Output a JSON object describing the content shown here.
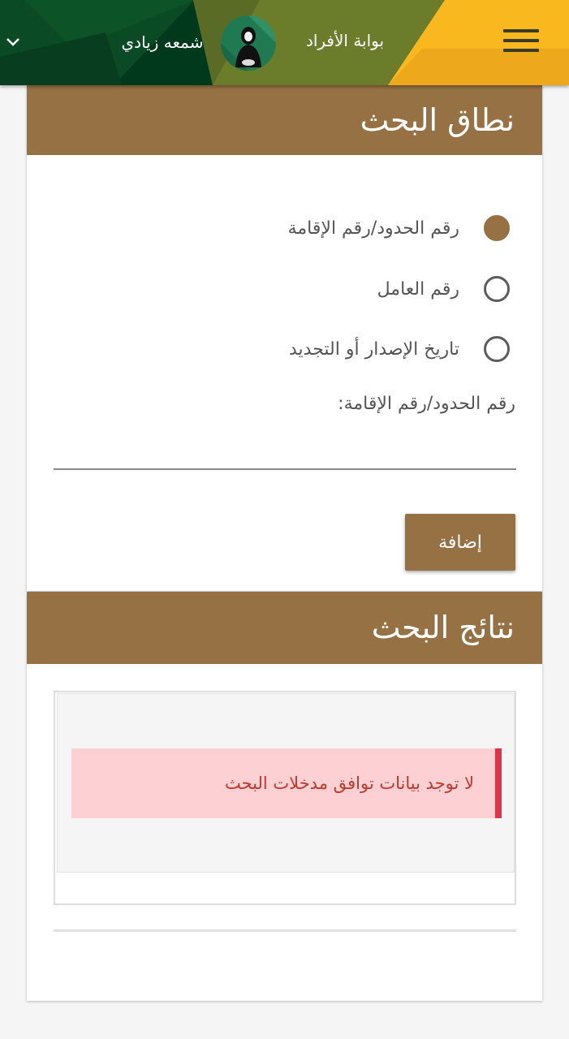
{
  "header": {
    "portal_title": "بوابة الأفراد",
    "user_name": "شمعه زيادي",
    "colors": {
      "green_dark": "#003a1c",
      "olive": "#6b7c2b",
      "yellow": "#f9b81e",
      "brown": "#967143"
    }
  },
  "search_scope": {
    "title": "نطاق البحث",
    "options": [
      {
        "label": "رقم الحدود/رقم الإقامة",
        "selected": true
      },
      {
        "label": "رقم العامل",
        "selected": false
      },
      {
        "label": "تاريخ الإصدار أو التجديد",
        "selected": false
      }
    ],
    "field_label": "رقم الحدود/رقم الإقامة:",
    "field_value": "",
    "add_button": "إضافة"
  },
  "search_results": {
    "title": "نتائج البحث",
    "empty_message": "لا توجد بيانات توافق مدخلات البحث"
  }
}
